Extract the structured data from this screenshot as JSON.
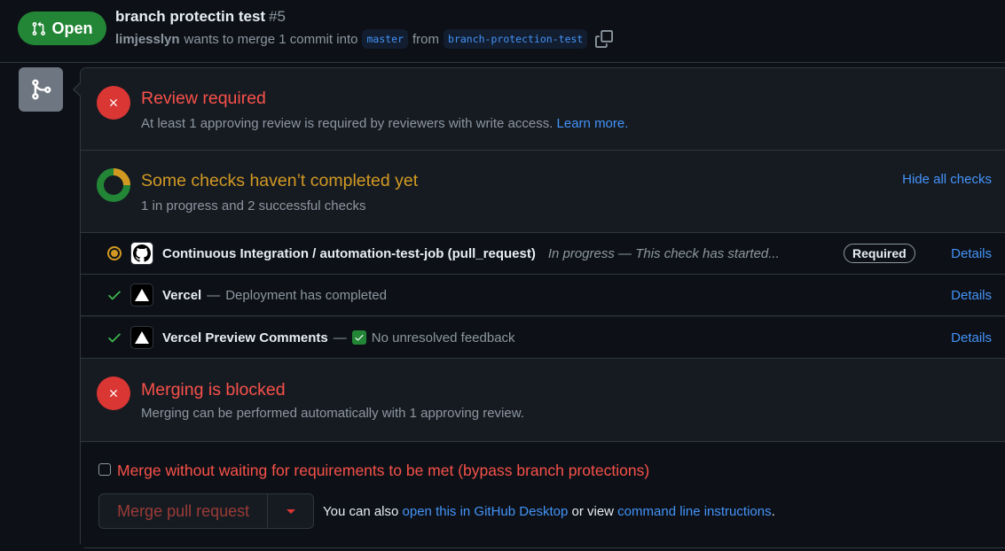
{
  "header": {
    "state": "Open",
    "title": "branch protectin test",
    "number": "#5",
    "author": "limjesslyn",
    "meta_text": "wants to merge 1 commit into",
    "base_branch": "master",
    "from_text": "from",
    "head_branch": "branch-protection-test"
  },
  "review": {
    "title": "Review required",
    "subtitle": "At least 1 approving review is required by reviewers with write access.",
    "learn_more": "Learn more."
  },
  "checks": {
    "title": "Some checks haven’t completed yet",
    "subtitle": "1 in progress and 2 successful checks",
    "hide_all": "Hide all checks",
    "rows": [
      {
        "name": "Continuous Integration / automation-test-job (pull_request)",
        "description": "In progress — This check has started...",
        "status": "in_progress",
        "avatar": "github-icon",
        "required_label": "Required",
        "details": "Details"
      },
      {
        "name": "Vercel",
        "separator": "—",
        "description": "Deployment has completed",
        "status": "success",
        "avatar": "vercel-icon",
        "details": "Details"
      },
      {
        "name": "Vercel Preview Comments",
        "separator": "—",
        "description": "No unresolved feedback",
        "status": "success",
        "avatar": "vercel-icon",
        "details": "Details"
      }
    ]
  },
  "blocked": {
    "title": "Merging is blocked",
    "subtitle": "Merging can be performed automatically with 1 approving review."
  },
  "bypass": {
    "label": "Merge without waiting for requirements to be met (bypass branch protections)",
    "merge_button": "Merge pull request",
    "also_prefix": "You can also",
    "desktop_link": "open this in GitHub Desktop",
    "or_view": "or view",
    "cli_link": "command line instructions",
    "period": "."
  },
  "colors": {
    "open_green": "#238636",
    "danger": "#f85149",
    "attention": "#d29922",
    "link": "#4493f8"
  }
}
